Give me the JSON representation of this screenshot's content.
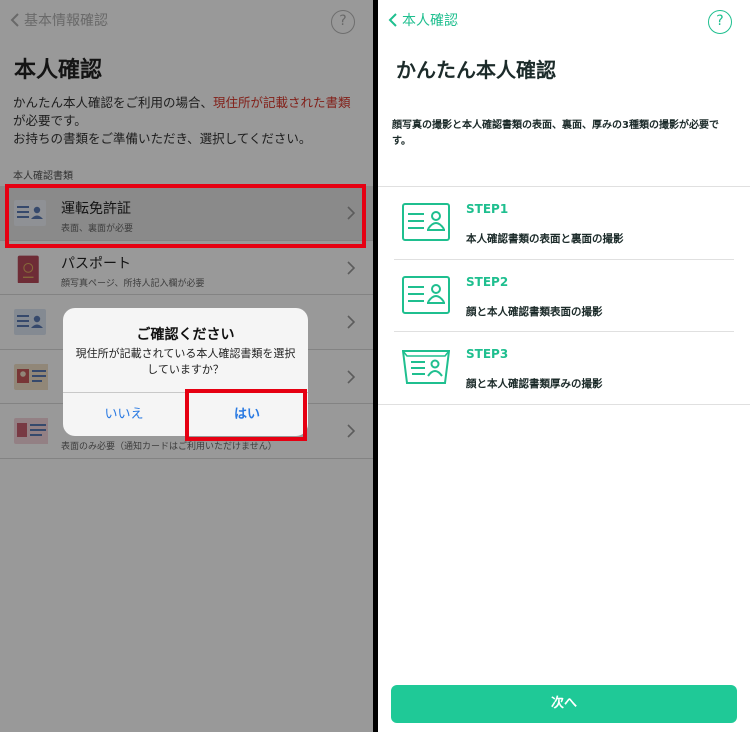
{
  "left": {
    "back_label": "基本情報確認",
    "help_label": "?",
    "title": "本人確認",
    "desc_line1_prefix": "かんたん本人確認をご利用の場合、",
    "desc_line1_highlight": "現住所が記載された書類",
    "desc_line2": "が必要です。",
    "desc_line3": "お持ちの書類をご準備いただき、選択してください。",
    "section_label": "本人確認書類",
    "documents": [
      {
        "name": "運転免許証",
        "sub": "表面、裏面が必要"
      },
      {
        "name": "パスポート",
        "sub": "顔写真ページ、所持人記入欄が必要"
      },
      {
        "name": "",
        "sub": ""
      },
      {
        "name": "",
        "sub": ""
      },
      {
        "name": "",
        "sub": "表面のみ必要（通知カードはご利用いただけません）"
      }
    ],
    "dialog": {
      "title": "ご確認ください",
      "message": "現住所が記載されている本人確認書類を選択していますか？",
      "no_label": "いいえ",
      "yes_label": "はい"
    },
    "highlight_color": "#e60012"
  },
  "right": {
    "back_label": "本人確認",
    "help_label": "?",
    "title": "かんたん本人確認",
    "desc": "顔写真の撮影と本人確認書類の表面、裏面、厚みの3種類の撮影が必要です。",
    "steps": [
      {
        "label": "STEP1",
        "desc": "本人確認書類の表面と裏面の撮影",
        "icon": "id-card-icon"
      },
      {
        "label": "STEP2",
        "desc": "顔と本人確認書類表面の撮影",
        "icon": "id-card-icon"
      },
      {
        "label": "STEP3",
        "desc": "顔と本人確認書類厚みの撮影",
        "icon": "id-card-tilted-icon"
      }
    ],
    "next_label": "次へ",
    "accent_color": "#1fc997"
  }
}
